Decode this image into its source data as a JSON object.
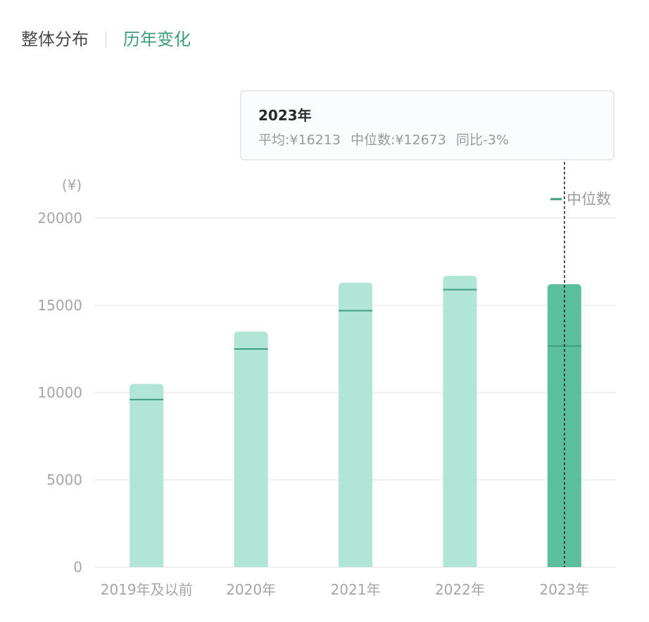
{
  "tabs": {
    "overall_label": "整体分布",
    "yearly_label": "历年变化"
  },
  "tooltip": {
    "title": "2023年",
    "average": "平均:¥16213",
    "median": "中位数:¥12673",
    "yoy": "同比-3%"
  },
  "colors": {
    "bar_light": "#b1e5d6",
    "bar_highlight": "#5bbf9d",
    "median_line": "#3f9c7c",
    "grid": "#ebebeb",
    "active_tab": "#3f9c7c"
  },
  "chart_data": {
    "type": "bar",
    "y_unit_label": "(¥)",
    "categories": [
      "2019年及以前",
      "2020年",
      "2021年",
      "2022年",
      "2023年"
    ],
    "series": [
      {
        "values": [
          10500,
          13500,
          16300,
          16700,
          16213
        ]
      },
      {
        "name": "中位数",
        "values": [
          9600,
          12500,
          14700,
          15900,
          12673
        ]
      }
    ],
    "highlight_index": 4,
    "ylim": [
      0,
      20000
    ],
    "yticks": [
      0,
      5000,
      10000,
      15000,
      20000
    ],
    "grid": true,
    "legend": {
      "position": "top-right",
      "label": "中位数"
    }
  }
}
